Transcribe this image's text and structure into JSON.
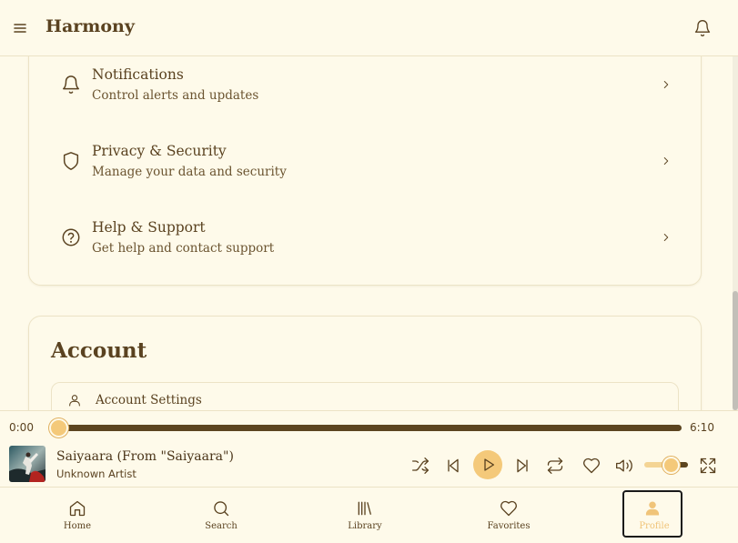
{
  "app": {
    "title": "Harmony"
  },
  "settings_rows": [
    {
      "title": "Notifications",
      "subtitle": "Control alerts and updates",
      "icon": "bell-icon"
    },
    {
      "title": "Privacy & Security",
      "subtitle": "Manage your data and security",
      "icon": "shield-icon"
    },
    {
      "title": "Help & Support",
      "subtitle": "Get help and contact support",
      "icon": "help-circle-icon"
    }
  ],
  "account": {
    "title": "Account",
    "items": [
      {
        "label": "Account Settings",
        "icon": "user-icon"
      }
    ]
  },
  "player": {
    "current_time": "0:00",
    "duration": "6:10",
    "progress": 0.0,
    "track_title": "Saiyaara (From \"Saiyaara\")",
    "artist": "Unknown Artist",
    "volume": 0.6,
    "controls": [
      "shuffle-icon",
      "skip-back-icon",
      "play-icon",
      "skip-forward-icon",
      "repeat-icon",
      "heart-icon",
      "volume-icon",
      "maximize-icon"
    ]
  },
  "nav": {
    "items": [
      {
        "label": "Home",
        "icon": "home-icon",
        "active": false
      },
      {
        "label": "Search",
        "icon": "search-icon",
        "active": false
      },
      {
        "label": "Library",
        "icon": "library-icon",
        "active": false
      },
      {
        "label": "Favorites",
        "icon": "heart-icon",
        "active": false
      },
      {
        "label": "Profile",
        "icon": "user-icon",
        "active": true
      }
    ]
  },
  "colors": {
    "background": "#fefaea",
    "text": "#5a4220",
    "accent": "#f4c97a",
    "progress": "#5c4520",
    "border": "#ece3c6"
  }
}
